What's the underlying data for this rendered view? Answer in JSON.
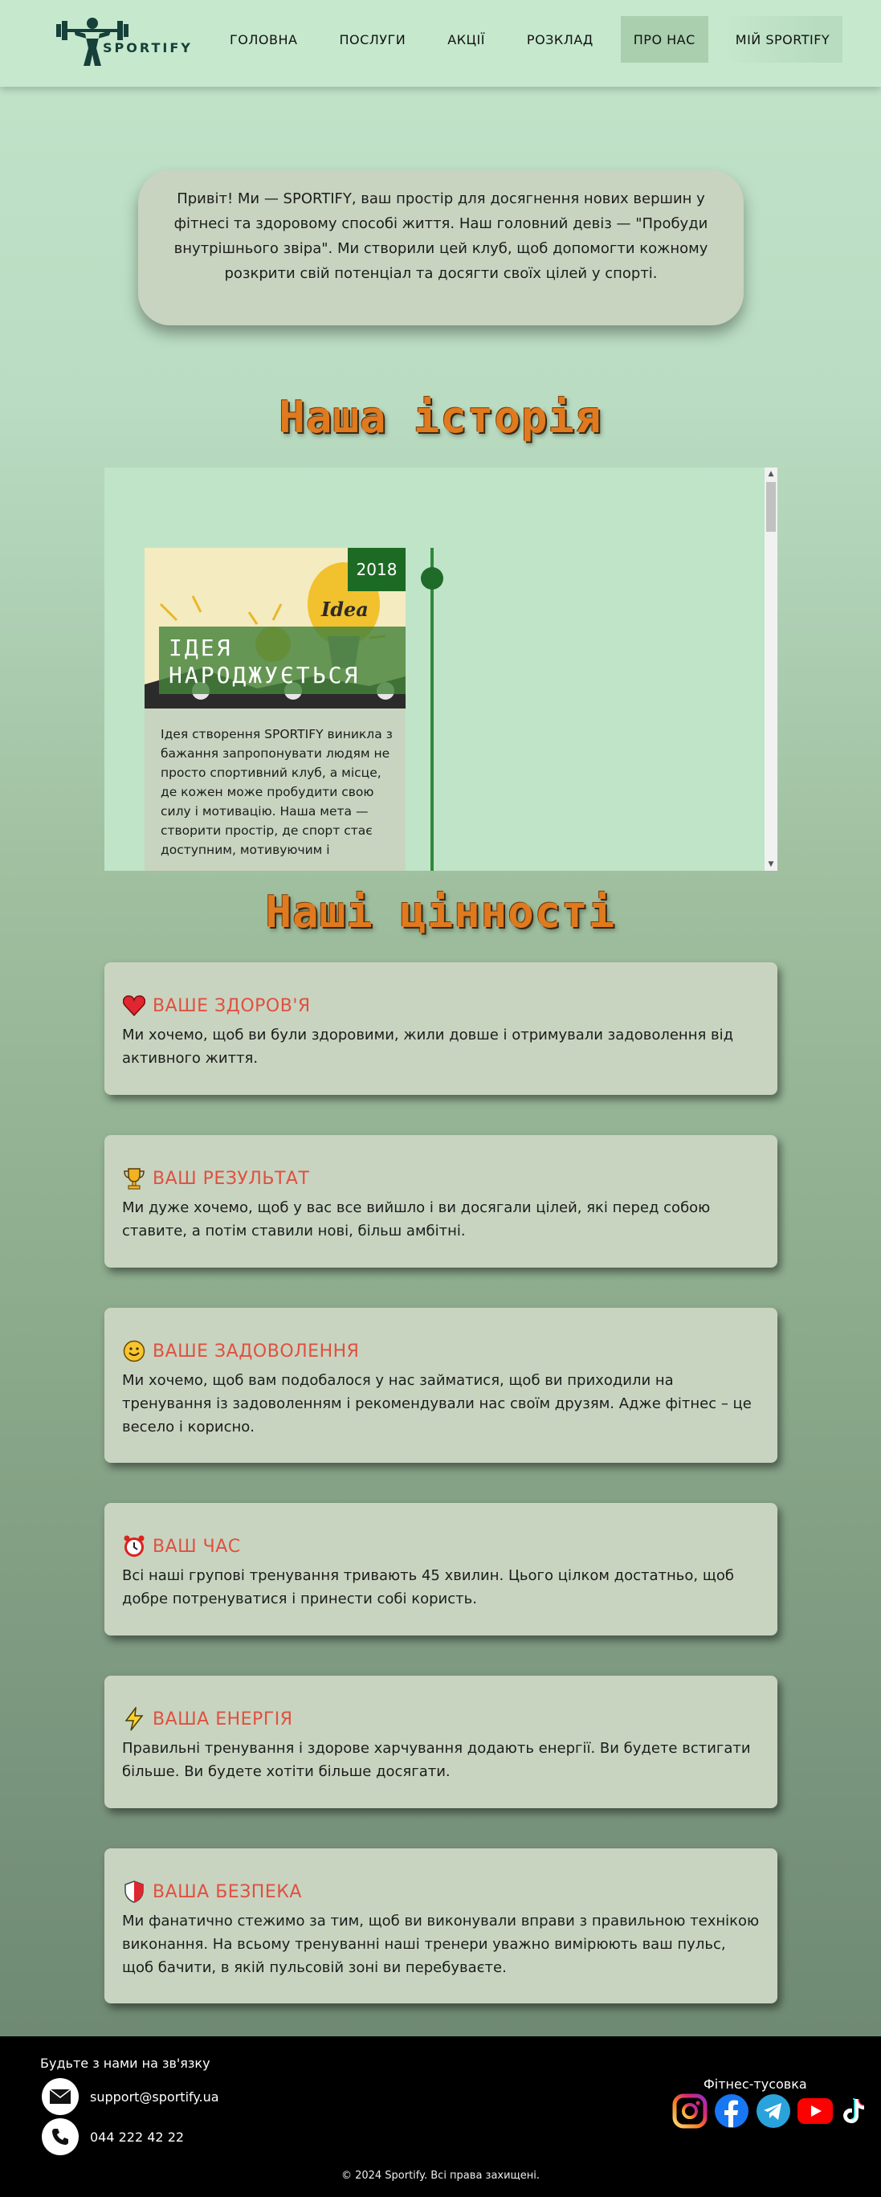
{
  "header": {
    "logo_text": "SPORTIFY",
    "nav": [
      "ГОЛОВНА",
      "ПОСЛУГИ",
      "АКЦІЇ",
      "РОЗКЛАД",
      "ПРО НАС",
      "МІЙ SPORTIFY"
    ],
    "active_nav": "ПРО НАС"
  },
  "intro": {
    "text": "Привіт! Ми — SPORTIFY, ваш простір для досягнення нових вершин у фітнесі та здоровому способі життя. Наш головний девіз — \"Пробуди внутрішнього звіра\". Ми створили цей клуб, щоб допомогти кожному розкрити свій потенціал та досягти своїх цілей у спорті."
  },
  "history": {
    "title": "Наша історія",
    "cards": [
      {
        "year": "2018",
        "title": "ІДЕЯ НАРОДЖУЄТЬСЯ",
        "image_word": "Idea",
        "text": "Ідея створення SPORTIFY виникла з бажання запропонувати людям не просто спортивний клуб, а місце, де кожен може пробудити свою силу і мотивацію. Наша мета — створити простір, де спорт стає доступним, мотивуючим і"
      }
    ]
  },
  "values": {
    "title": "Наші цінності",
    "items": [
      {
        "icon": "heart-icon",
        "title": "ВАШЕ ЗДОРОВ'Я",
        "text": "Ми хочемо, щоб ви були здоровими, жили довше і отримували задоволення від активного життя."
      },
      {
        "icon": "trophy-icon",
        "title": "ВАШ РЕЗУЛЬТАТ",
        "text": "Ми дуже хочемо, щоб у вас все вийшло і ви досягали цілей, які перед собою ставите, а потім ставили нові, більш амбітні."
      },
      {
        "icon": "smile-icon",
        "title": "ВАШЕ ЗАДОВОЛЕННЯ",
        "text": "Ми хочемо, щоб вам подобалося у нас займатися, щоб ви приходили на тренування із задоволенням і рекомендували нас своїм друзям. Адже фітнес – це весело і корисно."
      },
      {
        "icon": "alarm-clock-icon",
        "title": "ВАШ ЧАС",
        "text": "Всі наші групові тренування тривають 45 хвилин. Цього цілком достатньо, щоб добре потренуватися і принести собі користь."
      },
      {
        "icon": "lightning-icon",
        "title": "ВАША ЕНЕРГІЯ",
        "text": "Правильні тренування і здорове харчування додають енергії. Ви будете встигати більше. Ви будете хотіти більше досягати."
      },
      {
        "icon": "shield-icon",
        "title": "ВАША БЕЗПЕКА",
        "text": "Ми фанатично стежимо за тим, щоб ви виконували вправи з правильною технікою виконання. На всьому тренуванні наші тренери уважно вимірюють ваш пульс, щоб бачити, в якій пульсовій зоні ви перебуваєте."
      }
    ]
  },
  "footer": {
    "contact_title": "Будьте з нами на зв'язку",
    "email": "support@sportify.ua",
    "phone": "044 222 42 22",
    "social_title": "Фітнес-тусовка",
    "socials": [
      "instagram-icon",
      "facebook-icon",
      "telegram-icon",
      "youtube-icon",
      "tiktok-icon"
    ],
    "copyright": "© 2024 Sportify. Всі права захищені."
  },
  "colors": {
    "header_bg": "#c6e8cd",
    "card_bg": "#c8d4c0",
    "value_title": "#e05040",
    "section_title": "#e07a1f",
    "footer_bg": "#000000",
    "year_badge": "#1d6a24"
  }
}
